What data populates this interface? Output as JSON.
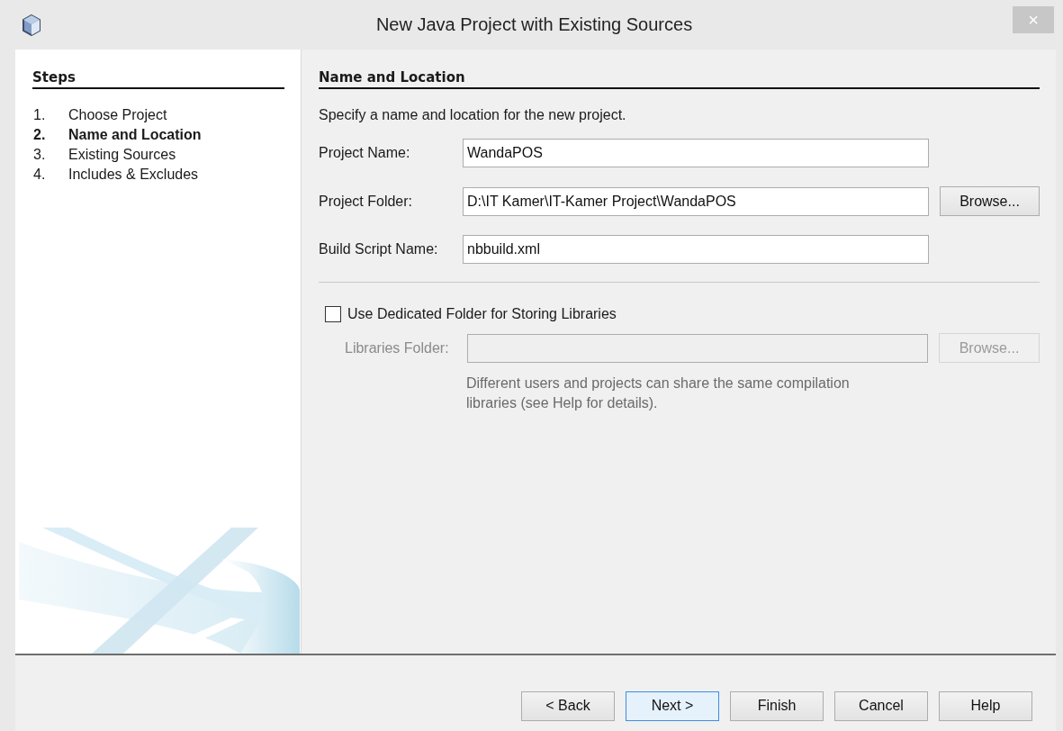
{
  "window": {
    "title": "New Java Project with Existing Sources",
    "close": "×"
  },
  "steps": {
    "heading": "Steps",
    "items": [
      {
        "number": "1.",
        "label": "Choose Project",
        "selected": false
      },
      {
        "number": "2.",
        "label": "Name and Location",
        "selected": true
      },
      {
        "number": "3.",
        "label": "Existing Sources",
        "selected": false
      },
      {
        "number": "4.",
        "label": "Includes & Excludes",
        "selected": false
      }
    ]
  },
  "panel": {
    "heading": "Name and Location",
    "intro": "Specify a name and location for the new project.",
    "fields": [
      {
        "label": "Project Name:",
        "value": "WandaPOS"
      },
      {
        "label": "Project Folder:",
        "value": "D:\\IT Kamer\\IT-Kamer Project\\WandaPOS",
        "button": "Browse..."
      },
      {
        "label": "Build Script Name:",
        "value": "nbbuild.xml"
      }
    ],
    "libraries": {
      "checkbox": "Use Dedicated Folder for Storing Libraries",
      "checked": false,
      "label": "Libraries Folder:",
      "button": "Browse...",
      "disabled": true,
      "note": "Different users and projects can share the same compilation libraries (see Help for details)."
    }
  },
  "buttons": [
    {
      "label": "< Back",
      "default": false
    },
    {
      "label": "Next >",
      "default": true
    },
    {
      "label": "Finish",
      "default": false
    },
    {
      "label": "Cancel",
      "default": false
    },
    {
      "label": "Help",
      "default": false
    }
  ]
}
